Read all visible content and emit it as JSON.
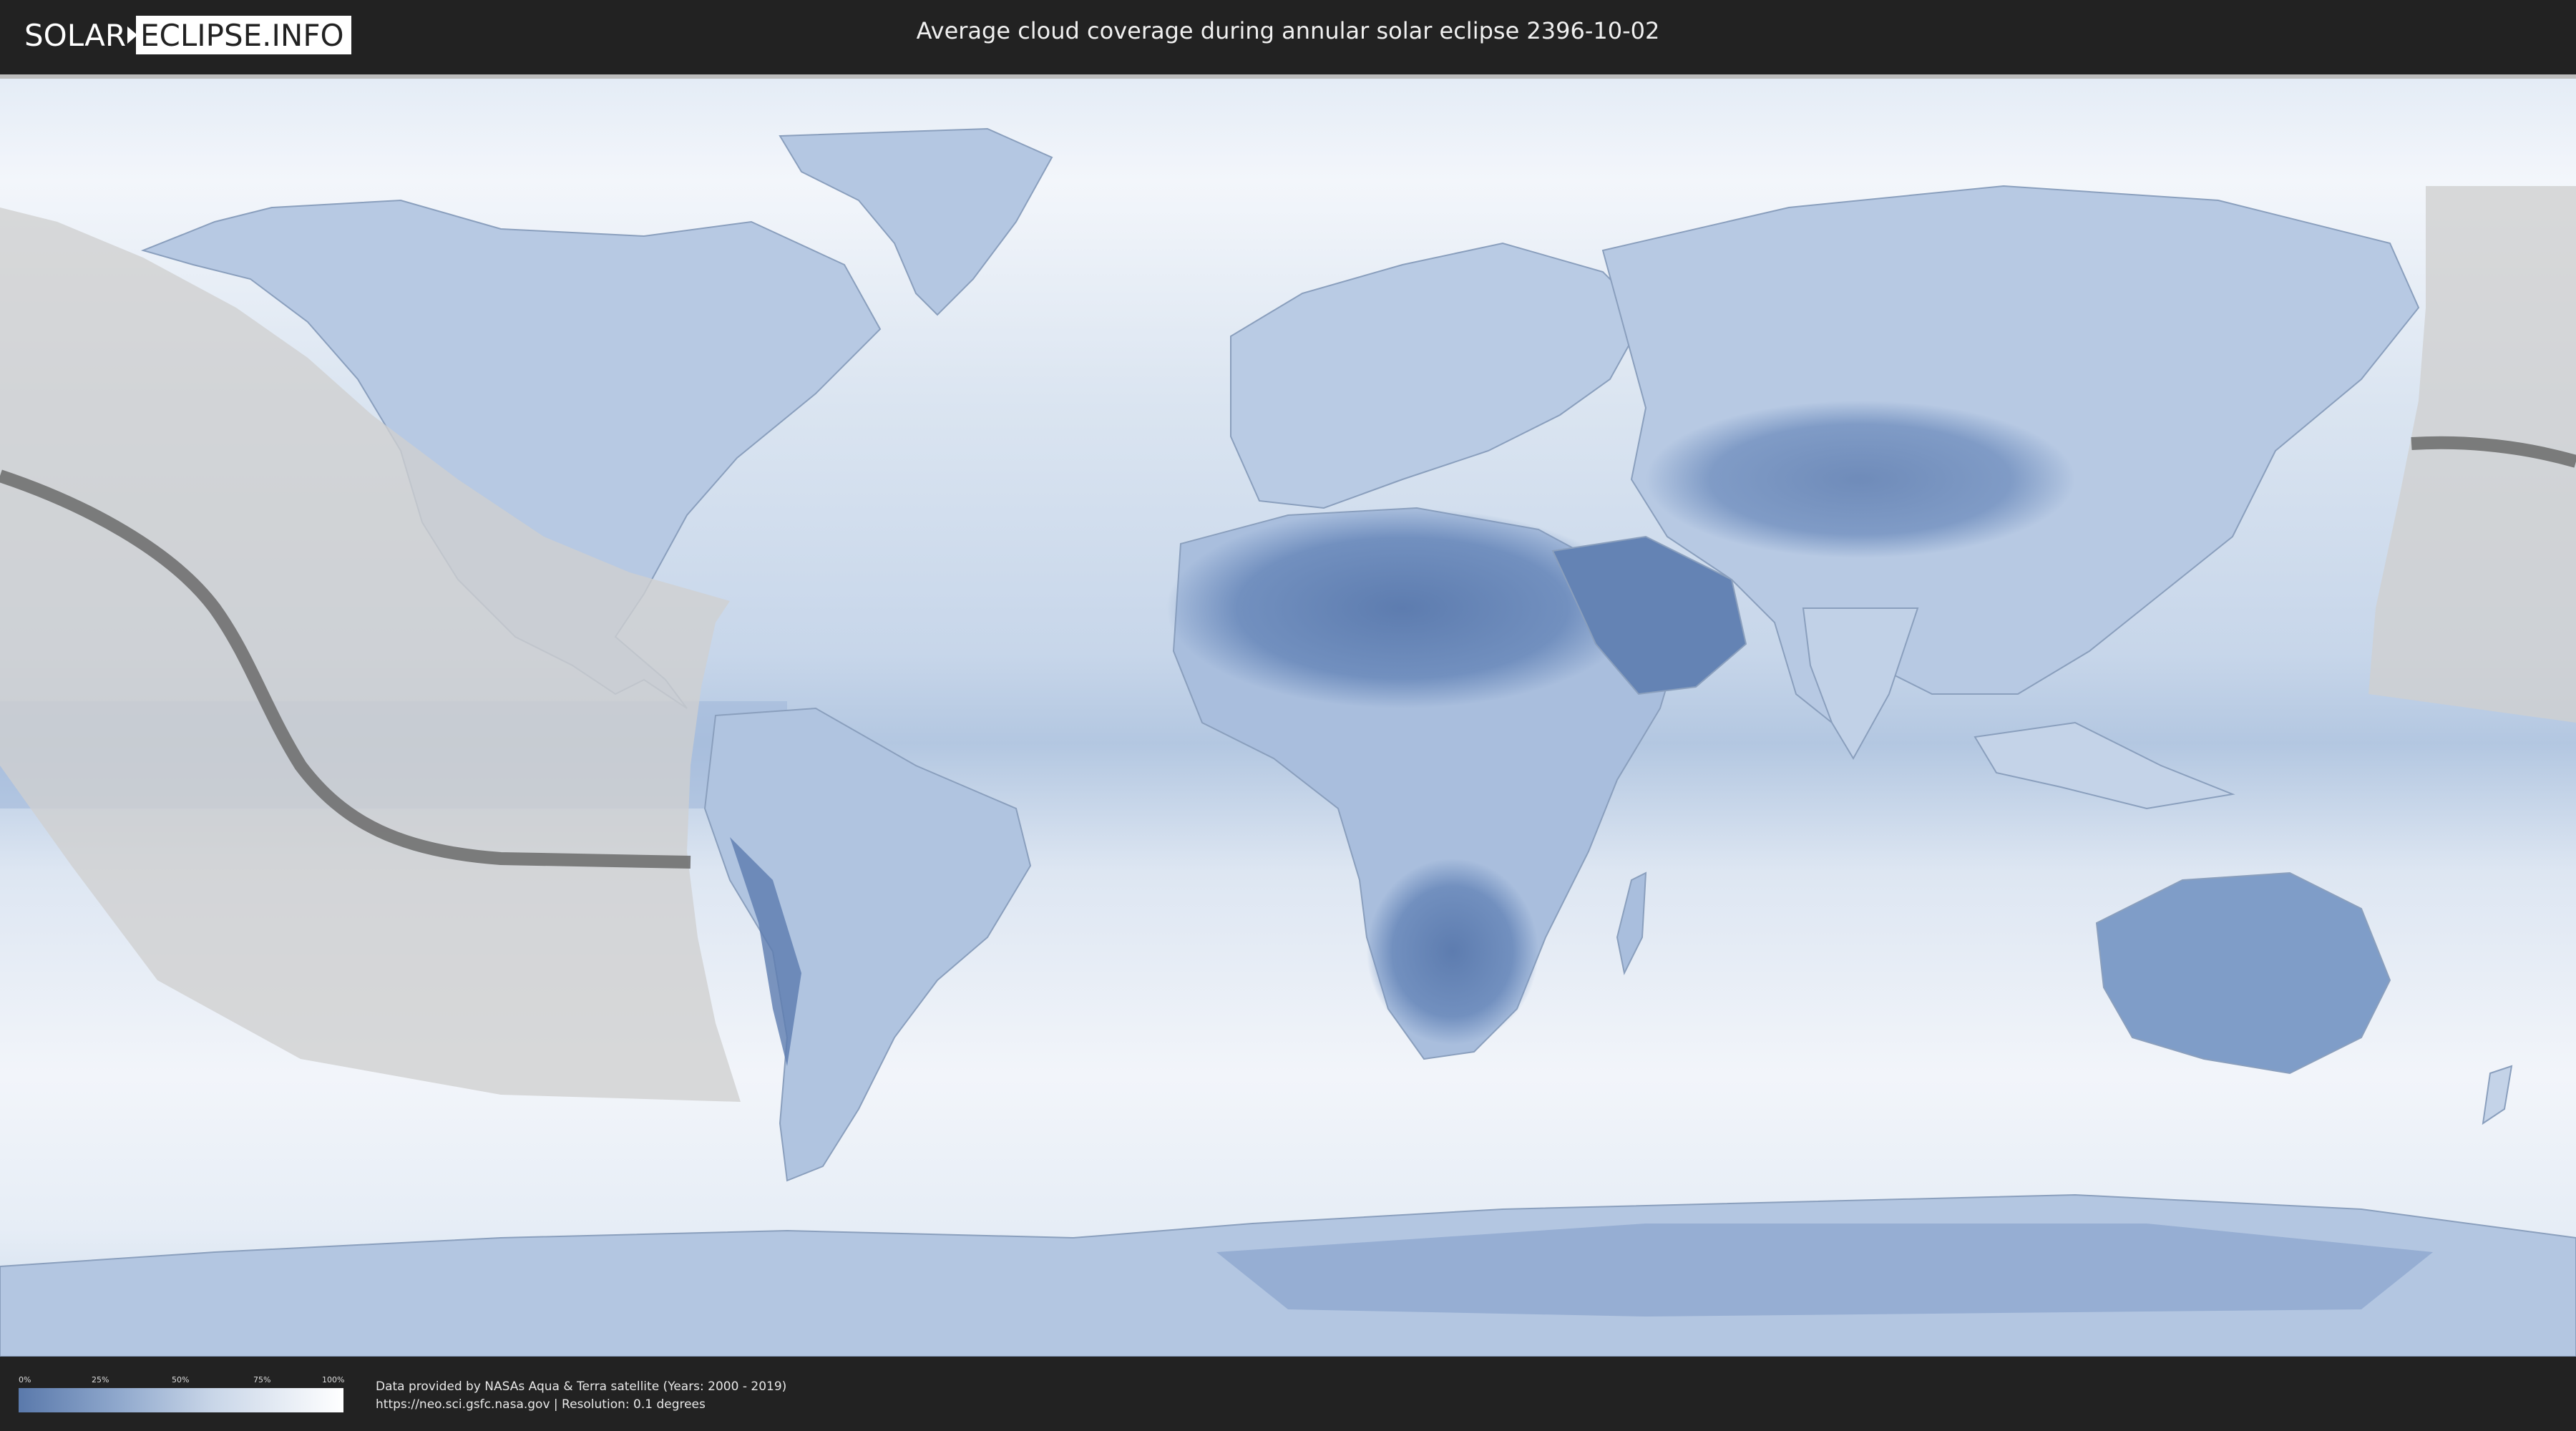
{
  "header": {
    "logo_left": "SOLAR",
    "logo_right": "ECLIPSE.INFO",
    "title": "Average cloud coverage during annular solar eclipse 2396-10-02"
  },
  "legend": {
    "ticks": [
      "0%",
      "25%",
      "50%",
      "75%",
      "100%"
    ],
    "gradient": [
      "#5a79ab",
      "#8ea7cc",
      "#c9d6e8",
      "#ffffff"
    ]
  },
  "footer": {
    "credit_line1": "Data provided by NASAs Aqua & Terra satellite (Years: 2000 - 2019)",
    "credit_line2": "https://neo.sci.gsfc.nasa.gov | Resolution: 0.1 degrees"
  },
  "map": {
    "type": "equirectangular cloud coverage map",
    "colors": {
      "clear_sky": "#5b7bad",
      "mid_cloud": "#a9bedc",
      "full_cloud": "#f5f8fc",
      "eclipse_zone": "#cfcfcf",
      "central_path": "#6b6b6b"
    }
  }
}
